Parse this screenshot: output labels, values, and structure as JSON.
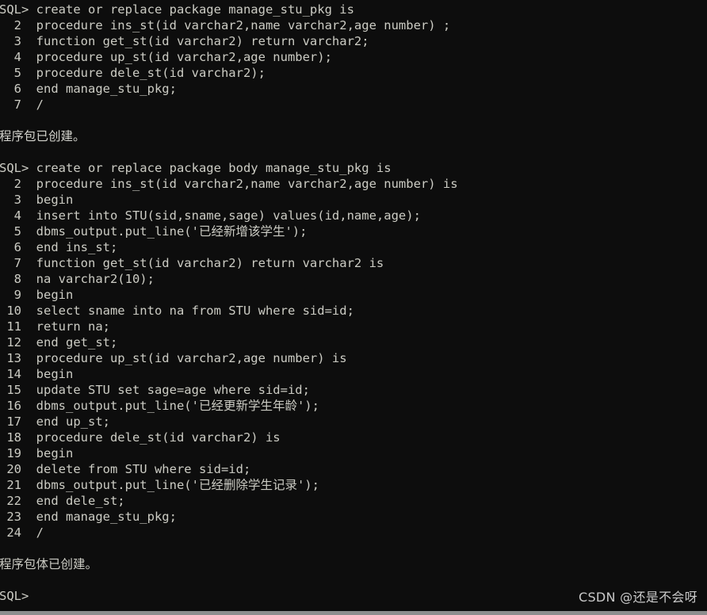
{
  "terminal": {
    "app": "SQL*Plus",
    "background_color": "#0d0d0d",
    "text_color": "#ccccc4",
    "prompt": "SQL>",
    "continuation_marker": "/",
    "lines": [
      "SQL> create or replace package manage_stu_pkg is",
      "  2  procedure ins_st(id varchar2,name varchar2,age number) ;",
      "  3  function get_st(id varchar2) return varchar2;",
      "  4  procedure up_st(id varchar2,age number);",
      "  5  procedure dele_st(id varchar2);",
      "  6  end manage_stu_pkg;",
      "  7  /",
      "",
      "程序包已创建。",
      "",
      "SQL> create or replace package body manage_stu_pkg is",
      "  2  procedure ins_st(id varchar2,name varchar2,age number) is",
      "  3  begin",
      "  4  insert into STU(sid,sname,sage) values(id,name,age);",
      "  5  dbms_output.put_line('已经新增该学生');",
      "  6  end ins_st;",
      "  7  function get_st(id varchar2) return varchar2 is",
      "  8  na varchar2(10);",
      "  9  begin",
      " 10  select sname into na from STU where sid=id;",
      " 11  return na;",
      " 12  end get_st;",
      " 13  procedure up_st(id varchar2,age number) is",
      " 14  begin",
      " 15  update STU set sage=age where sid=id;",
      " 16  dbms_output.put_line('已经更新学生年龄');",
      " 17  end up_st;",
      " 18  procedure dele_st(id varchar2) is",
      " 19  begin",
      " 20  delete from STU where sid=id;",
      " 21  dbms_output.put_line('已经删除学生记录');",
      " 22  end dele_st;",
      " 23  end manage_stu_pkg;",
      " 24  /",
      "",
      "程序包体已创建。",
      "",
      "SQL>"
    ],
    "message_line_indices": [
      8,
      34
    ]
  },
  "watermark": {
    "text": "CSDN @还是不会呀",
    "color": "#c9c9c9"
  }
}
